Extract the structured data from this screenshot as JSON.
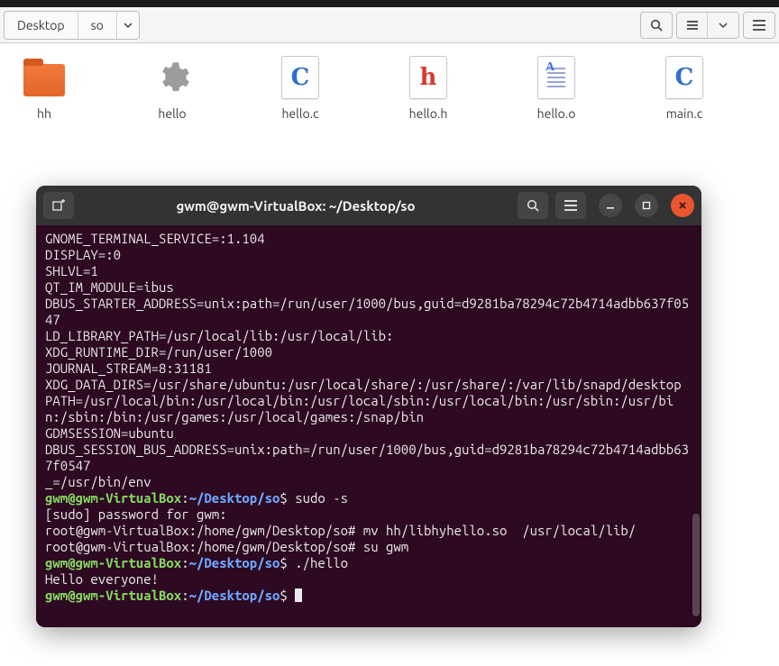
{
  "fm": {
    "breadcrumb": [
      "Desktop",
      "so"
    ],
    "files": [
      {
        "name": "hh",
        "kind": "folder"
      },
      {
        "name": "hello",
        "kind": "exec"
      },
      {
        "name": "hello.c",
        "kind": "c",
        "glyph": "C",
        "color": "#2f6fd1"
      },
      {
        "name": "hello.h",
        "kind": "h",
        "glyph": "h",
        "color": "#d53a2e"
      },
      {
        "name": "hello.o",
        "kind": "txt"
      },
      {
        "name": "main.c",
        "kind": "c",
        "glyph": "C",
        "color": "#2f6fd1"
      }
    ]
  },
  "terminal": {
    "title": "gwm@gwm-VirtualBox: ~/Desktop/so",
    "prompt_user": "gwm@gwm-VirtualBox",
    "prompt_path": "~/Desktop/so",
    "prompt_sep": ":",
    "prompt_end": "$",
    "root_prompt": "root@gwm-VirtualBox:/home/gwm/Desktop/so#",
    "lines_plain": [
      "GNOME_TERMINAL_SERVICE=:1.104",
      "DISPLAY=:0",
      "SHLVL=1",
      "QT_IM_MODULE=ibus",
      "DBUS_STARTER_ADDRESS=unix:path=/run/user/1000/bus,guid=d9281ba78294c72b4714adbb637f0547",
      "LD_LIBRARY_PATH=/usr/local/lib:/usr/local/lib:",
      "XDG_RUNTIME_DIR=/run/user/1000",
      "JOURNAL_STREAM=8:31181",
      "XDG_DATA_DIRS=/usr/share/ubuntu:/usr/local/share/:/usr/share/:/var/lib/snapd/desktop",
      "PATH=/usr/local/bin:/usr/local/bin:/usr/local/sbin:/usr/local/bin:/usr/sbin:/usr/bin:/sbin:/bin:/usr/games:/usr/local/games:/snap/bin",
      "GDMSESSION=ubuntu",
      "DBUS_SESSION_BUS_ADDRESS=unix:path=/run/user/1000/bus,guid=d9281ba78294c72b4714adbb637f0547",
      "_=/usr/bin/env"
    ],
    "cmd_sudo": " sudo -s",
    "line_sudo_pw": "[sudo] password for gwm:",
    "cmd_mv": " mv hh/libhyhello.so  /usr/local/lib/",
    "cmd_su": " su gwm",
    "cmd_hello": " ./hello",
    "out_hello": "Hello everyone!"
  }
}
